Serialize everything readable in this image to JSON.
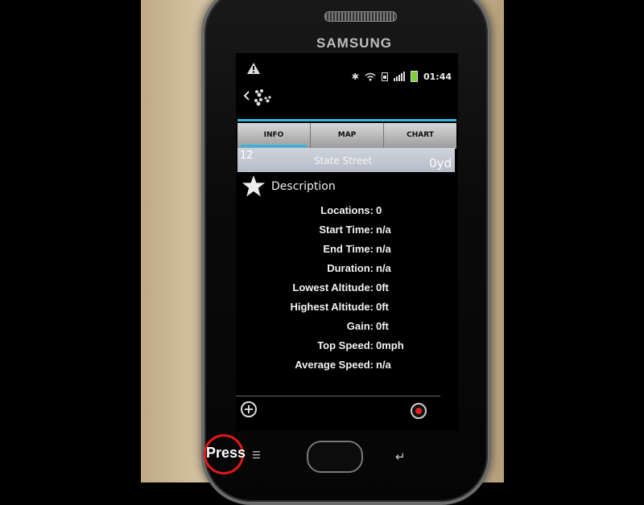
{
  "device": {
    "brand": "SAMSUNG"
  },
  "status_bar": {
    "time": "01:44"
  },
  "tabs": [
    {
      "label": "INFO",
      "active": true
    },
    {
      "label": "MAP",
      "active": false
    },
    {
      "label": "CHART",
      "active": false
    }
  ],
  "info_row": {
    "number": "12",
    "street": "State Street",
    "distance": "0yd"
  },
  "description": {
    "label": "Description"
  },
  "stats": [
    {
      "label": "Locations:",
      "value": "0"
    },
    {
      "label": "Start Time:",
      "value": "n/a"
    },
    {
      "label": "End Time:",
      "value": "n/a"
    },
    {
      "label": "Duration:",
      "value": "n/a"
    },
    {
      "label": "Lowest Altitude:",
      "value": "0ft"
    },
    {
      "label": "Highest Altitude:",
      "value": "0ft"
    },
    {
      "label": "Gain:",
      "value": "0ft"
    },
    {
      "label": "Top Speed:",
      "value": "0mph"
    },
    {
      "label": "Average Speed:",
      "value": "n/a"
    }
  ],
  "overlay": {
    "press_label": "Press"
  },
  "colors": {
    "accent": "#33b5e5",
    "record": "#e02020",
    "press_ring": "#e01919"
  }
}
